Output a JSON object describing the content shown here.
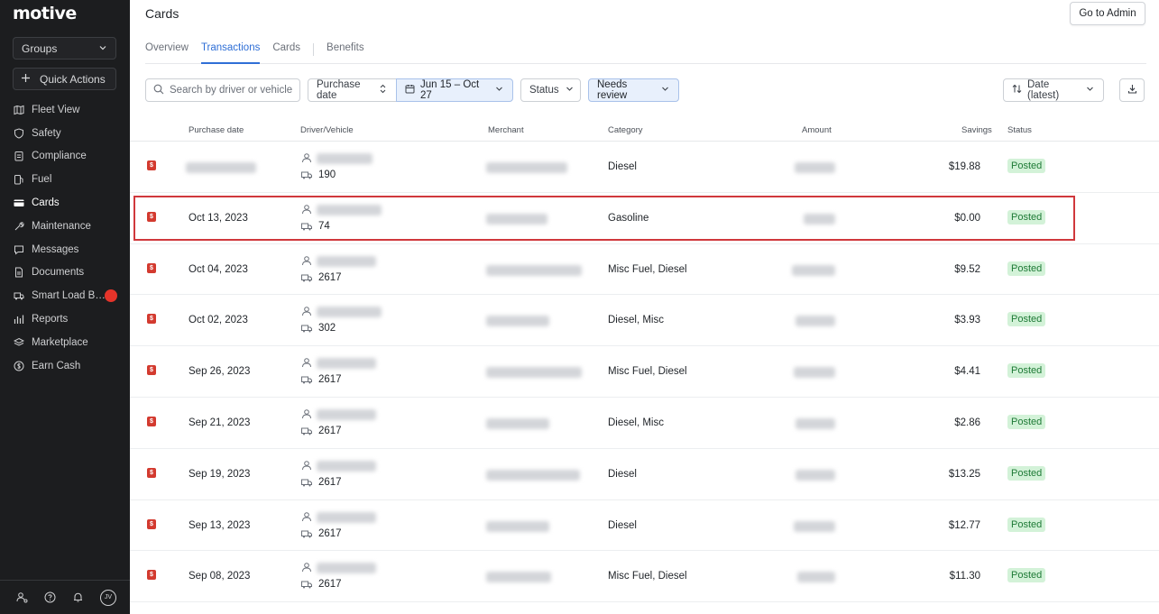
{
  "app": {
    "logo": "motive"
  },
  "sidebar": {
    "groups_label": "Groups",
    "quick_actions_label": "Quick Actions",
    "items": [
      {
        "label": "Fleet View",
        "icon": "map-icon"
      },
      {
        "label": "Safety",
        "icon": "shield-icon"
      },
      {
        "label": "Compliance",
        "icon": "clipboard-icon"
      },
      {
        "label": "Fuel",
        "icon": "fuel-icon"
      },
      {
        "label": "Cards",
        "icon": "card-icon"
      },
      {
        "label": "Maintenance",
        "icon": "wrench-icon"
      },
      {
        "label": "Messages",
        "icon": "message-icon"
      },
      {
        "label": "Documents",
        "icon": "document-icon"
      },
      {
        "label": "Smart Load B…",
        "icon": "truck-icon"
      },
      {
        "label": "Reports",
        "icon": "chart-icon"
      },
      {
        "label": "Marketplace",
        "icon": "layers-icon"
      },
      {
        "label": "Earn Cash",
        "icon": "dollar-icon"
      }
    ],
    "avatar_initials": "JV"
  },
  "header": {
    "title": "Cards",
    "admin_button": "Go to Admin"
  },
  "tabs": [
    "Overview",
    "Transactions",
    "Cards",
    "Benefits"
  ],
  "filters": {
    "search_placeholder": "Search by driver or vehicle",
    "purchase_date": "Purchase date",
    "date_range": "Jun 15 – Oct 27",
    "status": "Status",
    "needs_review": "Needs review",
    "sort": "Date (latest)"
  },
  "table": {
    "columns": [
      "Purchase date",
      "Driver/Vehicle",
      "Merchant",
      "Category",
      "Amount",
      "Savings",
      "Status"
    ],
    "rows": [
      {
        "date": "",
        "vehicle": "190",
        "category": "Diesel",
        "savings": "$19.88",
        "status": "Posted"
      },
      {
        "date": "Oct 13, 2023",
        "vehicle": "74",
        "category": "Gasoline",
        "savings": "$0.00",
        "status": "Posted"
      },
      {
        "date": "Oct 04, 2023",
        "vehicle": "2617",
        "category": "Misc Fuel, Diesel",
        "savings": "$9.52",
        "status": "Posted"
      },
      {
        "date": "Oct 02, 2023",
        "vehicle": "302",
        "category": "Diesel, Misc",
        "savings": "$3.93",
        "status": "Posted"
      },
      {
        "date": "Sep 26, 2023",
        "vehicle": "2617",
        "category": "Misc Fuel, Diesel",
        "savings": "$4.41",
        "status": "Posted"
      },
      {
        "date": "Sep 21, 2023",
        "vehicle": "2617",
        "category": "Diesel, Misc",
        "savings": "$2.86",
        "status": "Posted"
      },
      {
        "date": "Sep 19, 2023",
        "vehicle": "2617",
        "category": "Diesel",
        "savings": "$13.25",
        "status": "Posted"
      },
      {
        "date": "Sep 13, 2023",
        "vehicle": "2617",
        "category": "Diesel",
        "savings": "$12.77",
        "status": "Posted"
      },
      {
        "date": "Sep 08, 2023",
        "vehicle": "2617",
        "category": "Misc Fuel, Diesel",
        "savings": "$11.30",
        "status": "Posted"
      }
    ]
  }
}
